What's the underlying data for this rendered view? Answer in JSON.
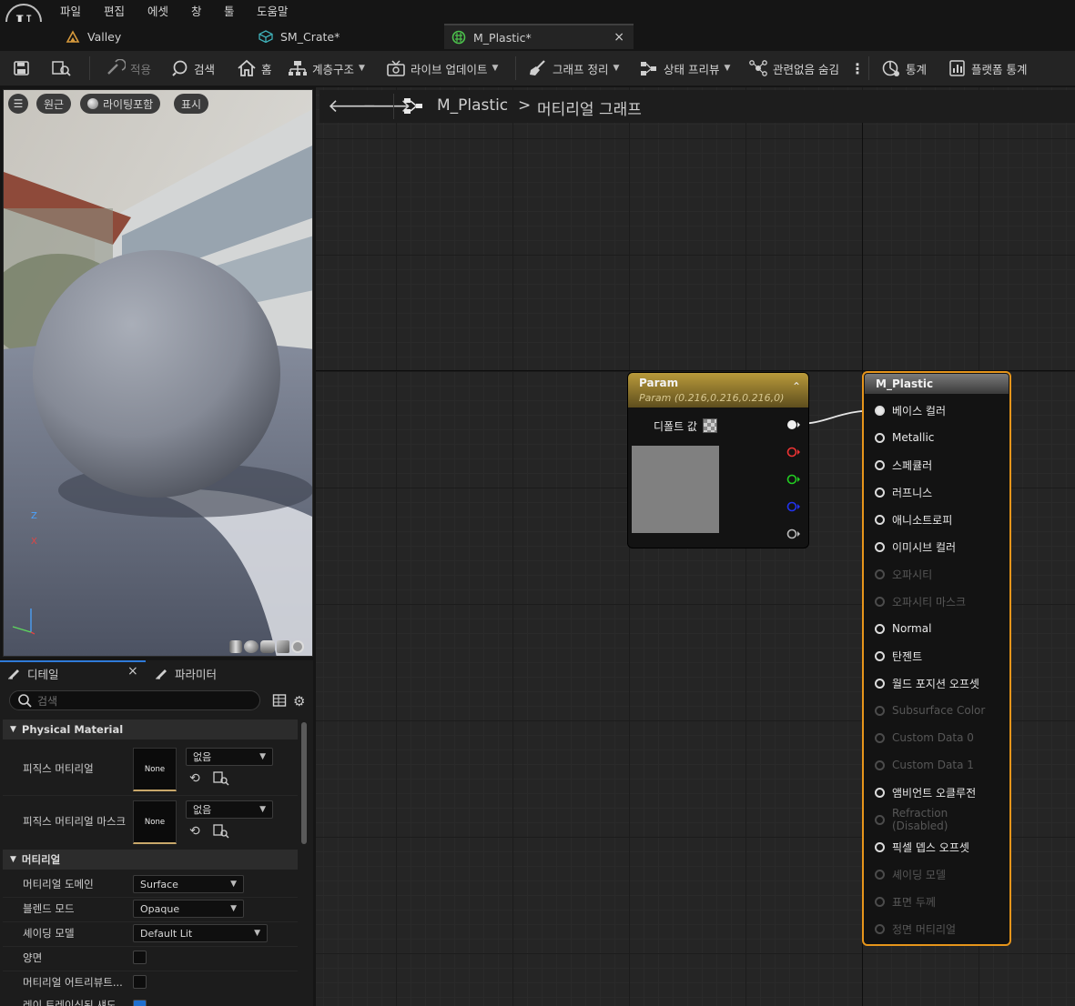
{
  "menu": [
    "파일",
    "편집",
    "에셋",
    "창",
    "툴",
    "도움말"
  ],
  "tabs": [
    {
      "label": "Valley",
      "icon": "level-icon"
    },
    {
      "label": "SM_Crate*",
      "icon": "static-mesh-icon"
    },
    {
      "label": "M_Plastic*",
      "icon": "material-icon",
      "close": "×"
    }
  ],
  "toolbar": {
    "apply": "적용",
    "search": "검색",
    "home": "홈",
    "hierarchy": "계층구조",
    "live_update": "라이브 업데이트",
    "clean_graph": "그래프 정리",
    "state_preview": "상태 프리뷰",
    "hide_unrelated": "관련없음 숨김",
    "stats": "통계",
    "platform_stats": "플랫폼 통계"
  },
  "viewport": {
    "perspective": "원근",
    "lighting": "라이팅포함",
    "show": "표시",
    "axis_z": "Z",
    "axis_x": "X"
  },
  "details": {
    "tab_details": "디테일",
    "tab_close": "×",
    "tab_params": "파라미터",
    "search_placeholder": "검색",
    "section_physical": "Physical Material",
    "phys_material": "피직스 머티리얼",
    "phys_material_mask": "피직스 머티리얼 마스크",
    "none": "None",
    "combo_none": "없음",
    "section_material": "머티리얼",
    "material_domain": "머티리얼 도메인",
    "material_domain_value": "Surface",
    "blend_mode": "블렌드 모드",
    "blend_mode_value": "Opaque",
    "shading_model": "셰이딩 모델",
    "shading_model_value": "Default Lit",
    "two_sided": "양면",
    "material_attributes": "머티리얼 어트리뷰트...",
    "cut_row": "레이 트레이싱된 섀도"
  },
  "graph": {
    "breadcrumb_asset": "M_Plastic",
    "breadcrumb_sep": ">",
    "breadcrumb_graph": "머티리얼 그래프",
    "param_node": {
      "title": "Param",
      "subtitle": "Param (0.216,0.216,0.216,0)",
      "default_label": "디폴트 값",
      "preview_color": "#808080"
    },
    "result_node": {
      "title": "M_Plastic",
      "pins": [
        {
          "label": "베이스 컬러",
          "enabled": true,
          "connected": true
        },
        {
          "label": "Metallic",
          "enabled": true
        },
        {
          "label": "스페큘러",
          "enabled": true
        },
        {
          "label": "러프니스",
          "enabled": true
        },
        {
          "label": "애니소트로피",
          "enabled": true
        },
        {
          "label": "이미시브 컬러",
          "enabled": true
        },
        {
          "label": "오파시티",
          "enabled": false
        },
        {
          "label": "오파시티 마스크",
          "enabled": false
        },
        {
          "label": "Normal",
          "enabled": true
        },
        {
          "label": "탄젠트",
          "enabled": true
        },
        {
          "label": "월드 포지션 오프셋",
          "enabled": true
        },
        {
          "label": "Subsurface Color",
          "enabled": false
        },
        {
          "label": "Custom Data 0",
          "enabled": false
        },
        {
          "label": "Custom Data 1",
          "enabled": false
        },
        {
          "label": "앰비언트 오클루전",
          "enabled": true
        },
        {
          "label": "Refraction (Disabled)",
          "enabled": false
        },
        {
          "label": "픽셀 뎁스 오프셋",
          "enabled": true
        },
        {
          "label": "셰이딩 모델",
          "enabled": false
        },
        {
          "label": "표면 두께",
          "enabled": false
        },
        {
          "label": "정면 머티리얼",
          "enabled": false
        }
      ]
    }
  },
  "colors": {
    "accent": "#e6951b",
    "param_header": "#b99a3a",
    "graph_bg": "#252525"
  }
}
